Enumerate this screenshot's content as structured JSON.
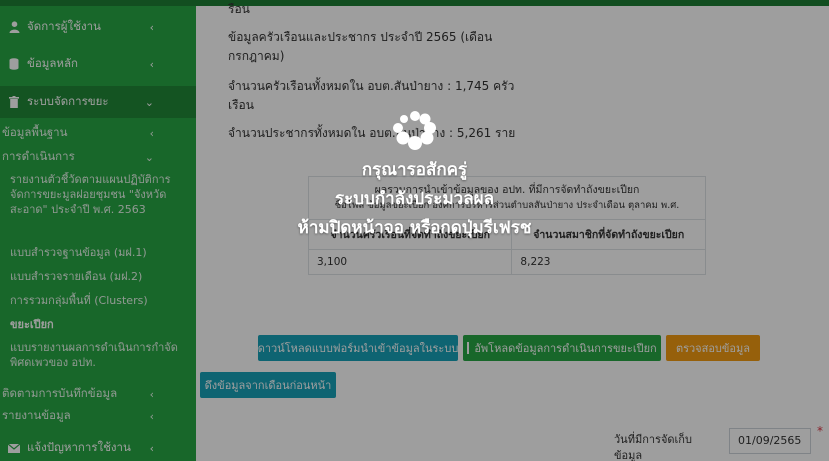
{
  "sidebar": {
    "items": [
      {
        "label": "จัดการผู้ใช้งาน",
        "icon": "user-icon"
      },
      {
        "label": "ข้อมูลหลัก",
        "icon": "database-icon"
      },
      {
        "label": "ระบบจัดการขยะ",
        "icon": "trash-icon"
      },
      {
        "label": "ข้อมูลพื้นฐาน"
      },
      {
        "label": "การดำเนินการ"
      }
    ],
    "subitems": [
      "รายงานตัวชี้วัดตามแผนปฏิบัติการจัดการขยะมูลฝอยชุมชน \"จังหวัดสะอาด\" ประจำปี พ.ศ. 2563",
      "แบบสำรวจฐานข้อมูล (มฝ.1)",
      "แบบสำรวจรายเดือน (มฝ.2)",
      "การรวมกลุ่มพื้นที่ (Clusters)",
      "ขยะเปียก",
      "แบบรายงานผลการดำเนินการกำจัดพิศดเพวของ อปท."
    ],
    "bottom_items": [
      {
        "label": "ติดตามการบันทึกข้อมูล"
      },
      {
        "label": "รายงานข้อมูล"
      },
      {
        "label": "แจ้งปัญหาการใช้งาน",
        "icon": "envelope-icon"
      }
    ]
  },
  "main": {
    "top_partial": "รือน",
    "info1": "ข้อมูลครัวเรือนและประชากร ประจำปี 2565 (เดือน กรกฎาคม)",
    "info2": "จำนวนครัวเรือนทั้งหมดใน อบต.สันป่ายาง : 1,745 ครัวเรือน",
    "info3": "จำนวนประชากรทั้งหมดใน อบต.สันป่ายาง : 5,261 ราย",
    "table": {
      "caption1": "ผลรวมการนำเข้าข้อมูลของ อปท. ที่มีการจัดทำถังขยะเปียก",
      "caption2": "ชื่อไฟล์ ข้อมูลขยะเปียก องค์การบริหารส่วนตำบลสันป่ายาง ประจำเดือน ตุลาคม พ.ศ.",
      "headers": [
        "จำนวนครัวเรือนที่จัดทำถังขยะเปียก",
        "จำนวนสมาชิกที่จัดทำถังขยะเปียก"
      ],
      "values": [
        "3,100",
        "8,223"
      ]
    },
    "buttons": {
      "download_form": "ดาวน์โหลดแบบฟอร์มนำเข้าข้อมูลในระบบ",
      "upload": "อัพโหลดข้อมูลการดำเนินการขยะเปียก",
      "verify": "ตรวจสอบข้อมูล",
      "pull_prev": "ดึงข้อมูลจากเดือนก่อนหน้า"
    },
    "date_label": "วันที่มีการจัดเก็บข้อมูล",
    "date_value": "01/09/2565",
    "required_mark": "*"
  },
  "overlay": {
    "line1": "กรุณารอสักครู่",
    "line2": "ระบบกำลังประมวลผล",
    "line3": "ห้ามปิดหน้าจอ หรือกดปุ่มรีเฟรช"
  },
  "colors": {
    "sidebar": "#28a745",
    "btn_info": "#17a2b8",
    "btn_success": "#28a745",
    "btn_warning": "#f39c12"
  }
}
